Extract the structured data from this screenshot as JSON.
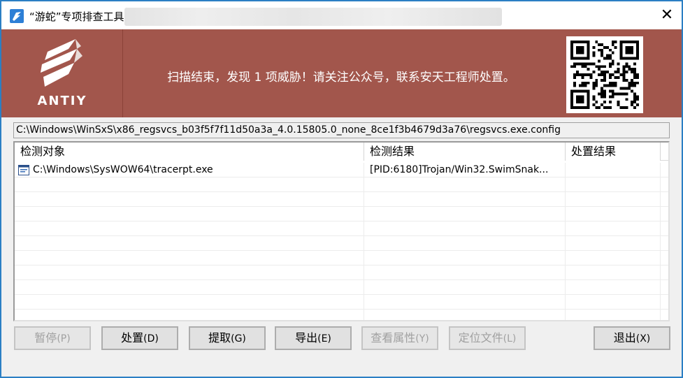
{
  "window": {
    "title": "“游蛇”专项排查工具",
    "close_glyph": "✕"
  },
  "banner": {
    "logo_text": "ANTIY",
    "message": "扫描结束，发现 1 项威胁！请关注公众号，联系安天工程师处置。"
  },
  "current_path": "C:\\Windows\\WinSxS\\x86_regsvcs_b03f5f7f11d50a3a_4.0.15805.0_none_8ce1f3b4679d3a76\\regsvcs.exe.config",
  "table": {
    "columns": [
      "检测对象",
      "检测结果",
      "处置结果"
    ],
    "rows": [
      {
        "icon": "exe-file-icon",
        "object": "C:\\Windows\\SysWOW64\\tracerpt.exe",
        "result": "[PID:6180]Trojan/Win32.SwimSnak...",
        "action": ""
      }
    ]
  },
  "buttons": {
    "pause": {
      "label": "暂停",
      "accel": "(P)"
    },
    "handle": {
      "label": "处置",
      "accel": "(D)"
    },
    "extract": {
      "label": "提取",
      "accel": "(G)"
    },
    "export": {
      "label": "导出",
      "accel": "(E)"
    },
    "properties": {
      "label": "查看属性",
      "accel": "(Y)"
    },
    "locate": {
      "label": "定位文件",
      "accel": "(L)"
    },
    "exit": {
      "label": "退出",
      "accel": "(X)"
    }
  },
  "colors": {
    "banner": "#a2564c",
    "window_border": "#2b7fc4"
  }
}
